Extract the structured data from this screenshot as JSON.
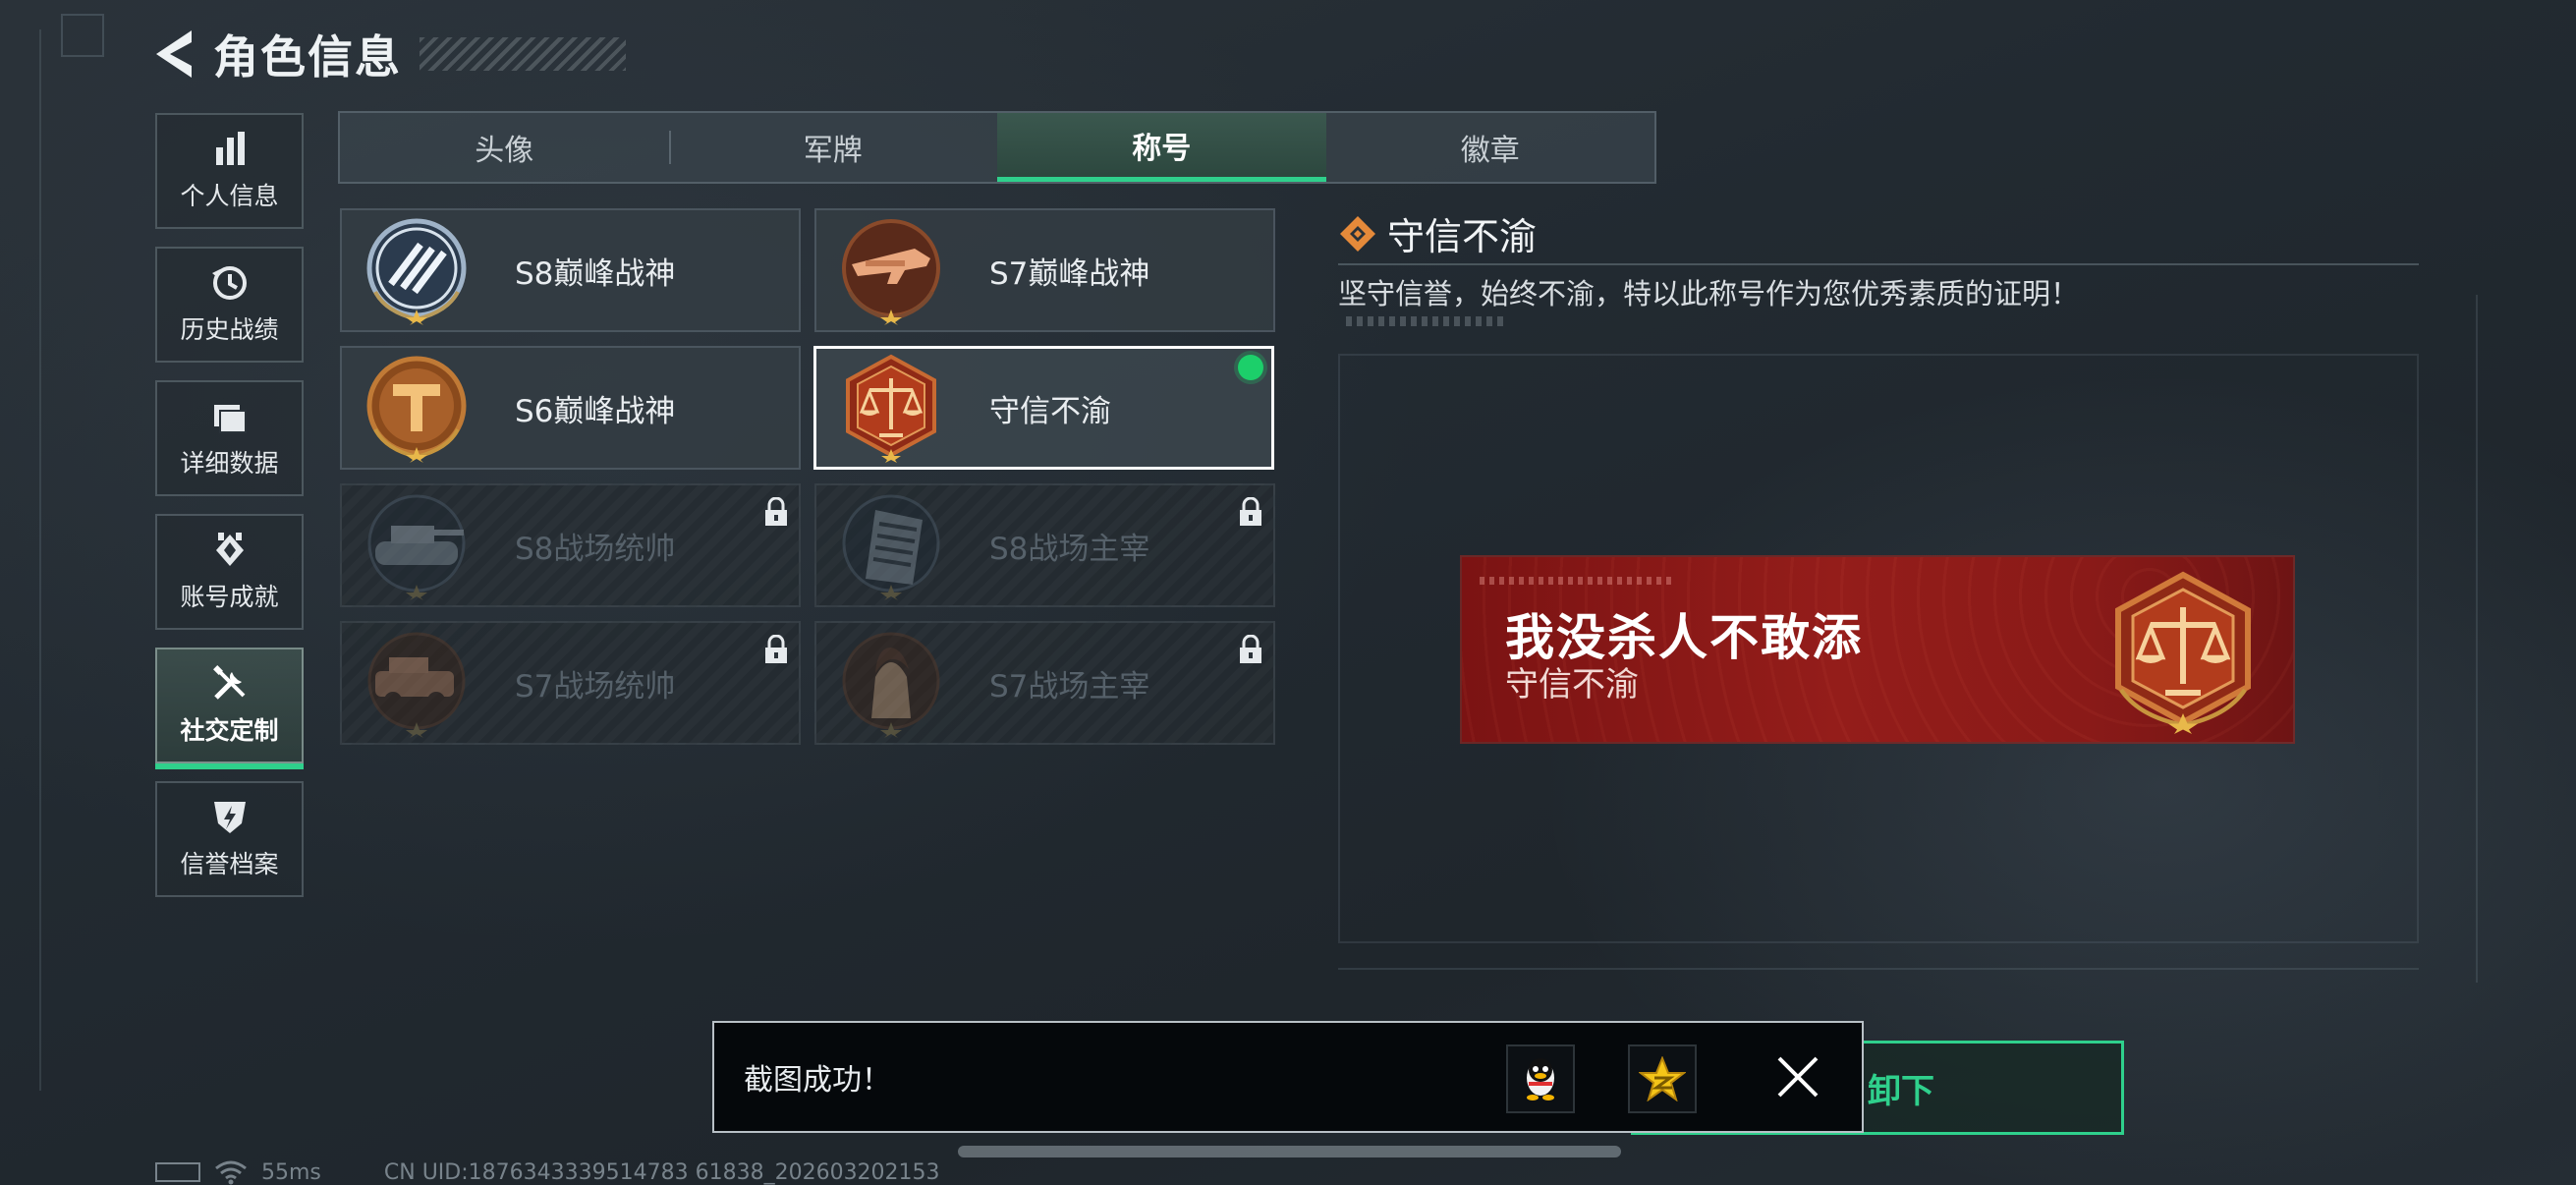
{
  "header": {
    "title": "角色信息"
  },
  "sidenav": {
    "items": [
      {
        "label": "个人信息",
        "icon": "bar-chart-icon",
        "active": false
      },
      {
        "label": "历史战绩",
        "icon": "history-icon",
        "active": false
      },
      {
        "label": "详细数据",
        "icon": "folder-icon",
        "active": false
      },
      {
        "label": "账号成就",
        "icon": "achievement-icon",
        "active": false
      },
      {
        "label": "社交定制",
        "icon": "tools-icon",
        "active": true
      },
      {
        "label": "信誉档案",
        "icon": "credit-shield-icon",
        "active": false
      }
    ]
  },
  "tabs": [
    {
      "label": "头像",
      "active": false
    },
    {
      "label": "军牌",
      "active": false
    },
    {
      "label": "称号",
      "active": true
    },
    {
      "label": "徽章",
      "active": false
    }
  ],
  "titles": [
    {
      "name": "S8巅峰战神",
      "locked": false,
      "selected": false
    },
    {
      "name": "S7巅峰战神",
      "locked": false,
      "selected": false
    },
    {
      "name": "S6巅峰战神",
      "locked": false,
      "selected": false
    },
    {
      "name": "守信不渝",
      "locked": false,
      "selected": true,
      "equipped": true
    },
    {
      "name": "S8战场统帅",
      "locked": true,
      "selected": false
    },
    {
      "name": "S8战场主宰",
      "locked": true,
      "selected": false
    },
    {
      "name": "S7战场统帅",
      "locked": true,
      "selected": false
    },
    {
      "name": "S7战场主宰",
      "locked": true,
      "selected": false
    }
  ],
  "detail": {
    "title": "守信不渝",
    "description": "坚守信誉，始终不渝，特以此称号作为您优秀素质的证明！"
  },
  "preview": {
    "player_name": "我没杀人不敢添",
    "title": "守信不渝"
  },
  "unequip_button": {
    "label": "卸下"
  },
  "toast": {
    "message": "截图成功！"
  },
  "status": {
    "ping": "55ms",
    "uid": "CN UID:1876343339514783 61838_202603202153"
  },
  "colors": {
    "accent_green": "#2fd08c",
    "banner_red": "#941d1a",
    "emblem_gold": "#c98a3c"
  }
}
